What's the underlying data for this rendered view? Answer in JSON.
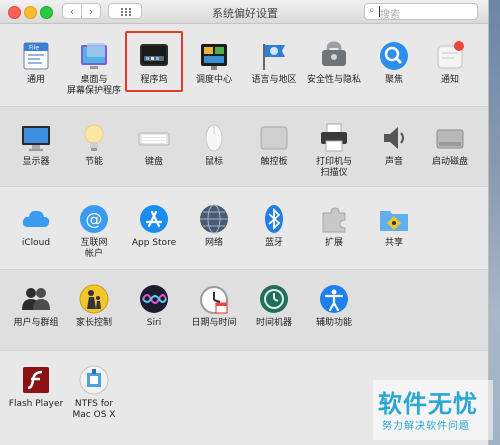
{
  "window": {
    "title": "系统偏好设置",
    "search_placeholder": "搜索"
  },
  "rows": [
    {
      "items": [
        {
          "label": "通用",
          "icon": "general-icon"
        },
        {
          "label": "桌面与\n屏幕保护程序",
          "icon": "desktop-icon"
        },
        {
          "label": "程序坞",
          "icon": "dock-icon"
        },
        {
          "label": "调度中心",
          "icon": "mission-control-icon"
        },
        {
          "label": "语言与地区",
          "icon": "language-region-icon"
        },
        {
          "label": "安全性与隐私",
          "icon": "security-icon"
        },
        {
          "label": "聚焦",
          "icon": "spotlight-icon"
        },
        {
          "label": "通知",
          "icon": "notifications-icon"
        }
      ]
    },
    {
      "items": [
        {
          "label": "显示器",
          "icon": "display-icon"
        },
        {
          "label": "节能",
          "icon": "energy-icon"
        },
        {
          "label": "键盘",
          "icon": "keyboard-icon"
        },
        {
          "label": "鼠标",
          "icon": "mouse-icon"
        },
        {
          "label": "触控板",
          "icon": "trackpad-icon"
        },
        {
          "label": "打印机与\n扫描仪",
          "icon": "printer-icon"
        },
        {
          "label": "声音",
          "icon": "sound-icon"
        },
        {
          "label": "启动磁盘",
          "icon": "startup-disk-icon"
        }
      ]
    },
    {
      "items": [
        {
          "label": "iCloud",
          "icon": "icloud-icon"
        },
        {
          "label": "互联网\n帐户",
          "icon": "internet-accounts-icon"
        },
        {
          "label": "App Store",
          "icon": "app-store-icon"
        },
        {
          "label": "网络",
          "icon": "network-icon"
        },
        {
          "label": "蓝牙",
          "icon": "bluetooth-icon"
        },
        {
          "label": "扩展",
          "icon": "extensions-icon"
        },
        {
          "label": "共享",
          "icon": "sharing-icon"
        }
      ]
    },
    {
      "items": [
        {
          "label": "用户与群组",
          "icon": "users-icon"
        },
        {
          "label": "家长控制",
          "icon": "parental-icon"
        },
        {
          "label": "Siri",
          "icon": "siri-icon"
        },
        {
          "label": "日期与时间",
          "icon": "date-time-icon"
        },
        {
          "label": "时间机器",
          "icon": "time-machine-icon"
        },
        {
          "label": "辅助功能",
          "icon": "accessibility-icon"
        }
      ]
    },
    {
      "items": [
        {
          "label": "Flash Player",
          "icon": "flash-player-icon"
        },
        {
          "label": "NTFS for\nMac OS X",
          "icon": "ntfs-icon"
        }
      ]
    }
  ],
  "watermark": {
    "main": "软件无忧",
    "sub": "努力解决软件问题"
  }
}
